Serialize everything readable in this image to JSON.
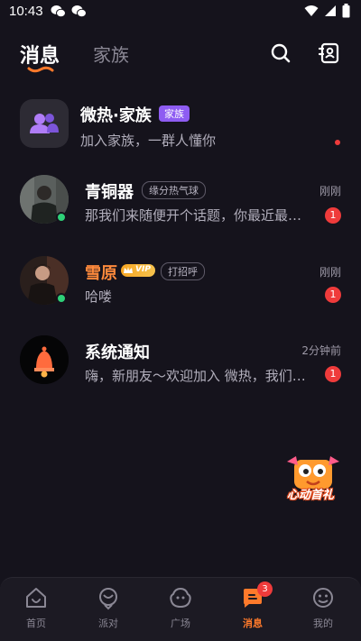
{
  "status_bar": {
    "time": "10:43"
  },
  "header": {
    "tab_active": "消息",
    "tab_inactive": "家族"
  },
  "conversations": [
    {
      "name": "微热·家族",
      "tag": "家族",
      "preview": "加入家族，一群人懂你",
      "time": "",
      "badge": ""
    },
    {
      "name": "青铜器",
      "tag": "缘分热气球",
      "preview": "那我们来随便开个话题，你最近最…",
      "time": "刚刚",
      "badge": "1",
      "online": true
    },
    {
      "name": "雪原",
      "tag": "打招呼",
      "vip": "VIP",
      "preview": "哈喽",
      "time": "刚刚",
      "badge": "1",
      "online": true
    },
    {
      "name": "系统通知",
      "preview": "嗨，新朋友～欢迎加入 微热，我们…",
      "time": "2分钟前",
      "badge": "1"
    }
  ],
  "floating": {
    "label": "心动首礼"
  },
  "bottom_nav": [
    {
      "label": "首页",
      "icon": "home-icon"
    },
    {
      "label": "派对",
      "icon": "party-icon"
    },
    {
      "label": "广场",
      "icon": "square-icon"
    },
    {
      "label": "消息",
      "icon": "message-icon",
      "active": true,
      "badge": "3"
    },
    {
      "label": "我的",
      "icon": "profile-icon"
    }
  ],
  "colors": {
    "accent": "#ff7a2b",
    "background": "#15131c",
    "badge": "#ef3b3b",
    "online": "#2ed178",
    "family_tag": "#8e5cf2"
  }
}
